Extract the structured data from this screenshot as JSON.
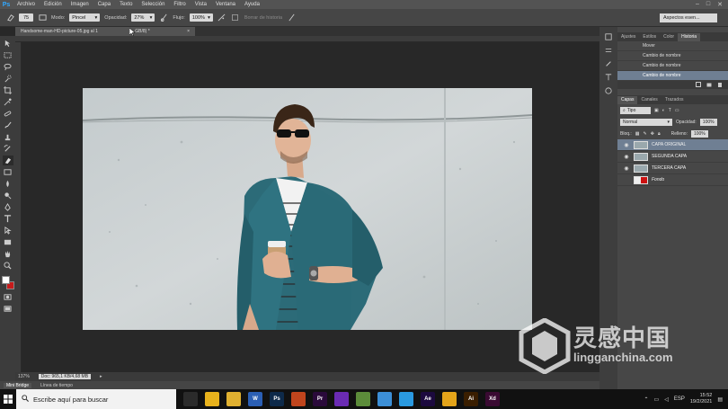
{
  "app": {
    "logo": "Ps"
  },
  "menu": [
    "Archivo",
    "Edición",
    "Imagen",
    "Capa",
    "Texto",
    "Selección",
    "Filtro",
    "Vista",
    "Ventana",
    "Ayuda"
  ],
  "window_controls": {
    "minimize": "–",
    "maximize": "□",
    "close": "✕"
  },
  "options": {
    "size": "75",
    "mode_label": "Modo:",
    "mode_value": "Pincel",
    "opacity_label": "Opacidad:",
    "opacity_value": "27%",
    "flow_label": "Flujo:",
    "flow_value": "100%",
    "erase_history_label": "Borrar de historia",
    "workspace": "Aspectos esen..."
  },
  "document": {
    "tab_title": "Handsome-man-HD-picture-05.jpg al 1",
    "tab_suffix": "GB/8) *",
    "tab_close": "×"
  },
  "status": {
    "zoom": "137%",
    "doc_info": "Doc: 965,1 KB/4,68 MB",
    "arrow": "▸"
  },
  "bridge_tabs": [
    "Mini Bridge",
    "Línea de tiempo"
  ],
  "history_panel": {
    "tabs": [
      "Ajustes",
      "Estilos",
      "Color",
      "Historia"
    ],
    "active_tab": 3,
    "items": [
      "Mover",
      "Cambio de nombre",
      "Cambio de nombre",
      "Cambio de nombre"
    ],
    "selected": 3
  },
  "layers_panel": {
    "tabs": [
      "Capas",
      "Canales",
      "Trazados"
    ],
    "active_tab": 0,
    "filter_label": "Tipo",
    "blend_mode": "Normal",
    "opacity_label": "Opacidad:",
    "opacity_value": "100%",
    "lock_label": "Bloq.:",
    "fill_label": "Relleno:",
    "fill_value": "100%",
    "layers": [
      {
        "name": "CAPA ORIGINAL",
        "visible": true,
        "selected": true
      },
      {
        "name": "SEGUNDA CAPA",
        "visible": true,
        "selected": false
      },
      {
        "name": "TERCERA CAPA",
        "visible": true,
        "selected": false
      },
      {
        "name": "Fondo",
        "visible": false,
        "selected": false
      }
    ]
  },
  "taskbar": {
    "search_placeholder": "Escribe aquí para buscar",
    "apps": [
      {
        "label": "",
        "color": "#2b2b2b",
        "icon": "task-view-icon"
      },
      {
        "label": "",
        "color": "#e8b21c",
        "icon": "chrome-icon"
      },
      {
        "label": "",
        "color": "#e0b030",
        "icon": "folder-icon"
      },
      {
        "label": "W",
        "color": "#2b5fb4",
        "icon": "word-icon"
      },
      {
        "label": "Ps",
        "color": "#0e2a4a",
        "icon": "photoshop-icon"
      },
      {
        "label": "",
        "color": "#c0451d",
        "icon": "app-orange-icon"
      },
      {
        "label": "Pr",
        "color": "#2a0a3a",
        "icon": "premiere-icon"
      },
      {
        "label": "",
        "color": "#6a2bb3",
        "icon": "app-purple-icon"
      },
      {
        "label": "",
        "color": "#5c8c3a",
        "icon": "app-green-icon"
      },
      {
        "label": "",
        "color": "#3c8fd6",
        "icon": "app-blue-icon"
      },
      {
        "label": "",
        "color": "#2a9ae0",
        "icon": "edge-icon"
      },
      {
        "label": "Ae",
        "color": "#1c0a3e",
        "icon": "after-effects-icon"
      },
      {
        "label": "",
        "color": "#e3a41a",
        "icon": "app-yellow-icon"
      },
      {
        "label": "Ai",
        "color": "#3a1e00",
        "icon": "illustrator-icon"
      },
      {
        "label": "Xd",
        "color": "#3a0a32",
        "icon": "xd-icon"
      }
    ],
    "lang": "ESP",
    "time": "15:52",
    "date": "19/2/2021"
  },
  "watermark": {
    "cn": "灵感中国",
    "en": "lingganchina.com"
  },
  "colors": {
    "foreground": "#ffffff",
    "background": "#c61b1b",
    "selection": "#6f7f93"
  }
}
